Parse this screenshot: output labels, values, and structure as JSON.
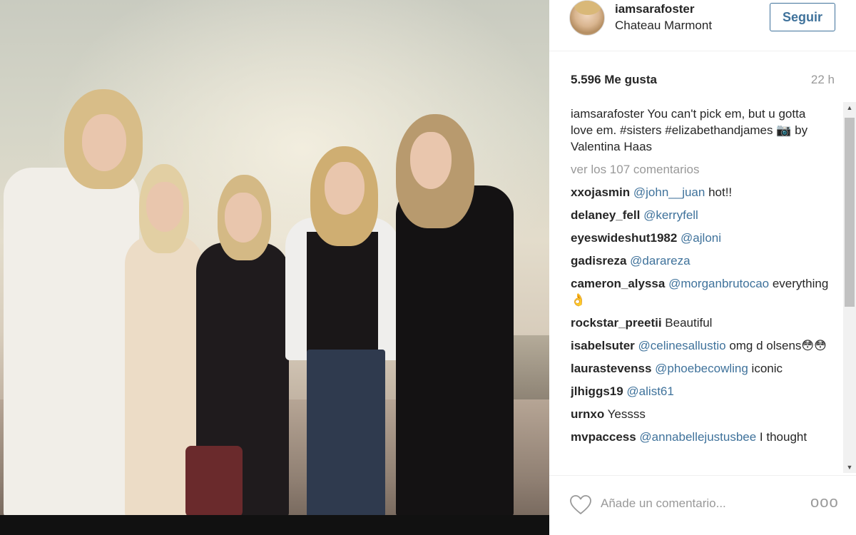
{
  "post": {
    "username": "iamsarafoster",
    "location": "Chateau Marmont",
    "follow_label": "Seguir",
    "likes": "5.596 Me gusta",
    "time": "22 h",
    "image_alt": "Group photo of five women at sunset on a terrace"
  },
  "caption": {
    "username": "iamsarafoster",
    "text_1": " You can't pick em, but u gotta love em. ",
    "hashtag_1": "#sisters",
    "hashtag_2": "#elizabethandjames",
    "text_2": " 📷 by Valentina Haas"
  },
  "view_all_comments": "ver los 107 comentarios",
  "comments": [
    {
      "user": "xxojasmin",
      "mention": "@john__juan",
      "text": " hot!!"
    },
    {
      "user": "delaney_fell",
      "mention": "@kerryfell",
      "text": ""
    },
    {
      "user": "eyeswideshut1982",
      "mention": "@ajloni",
      "text": ""
    },
    {
      "user": "gadisreza",
      "mention": "@darareza",
      "text": ""
    },
    {
      "user": "cameron_alyssa",
      "mention": "@morganbrutocao",
      "text": " everything 👌"
    },
    {
      "user": "rockstar_preetii",
      "mention": "",
      "text": " Beautiful"
    },
    {
      "user": "isabelsuter",
      "mention": "@celinesallustio",
      "text": " omg d olsens😳😳"
    },
    {
      "user": "laurastevenss",
      "mention": "@phoebecowling",
      "text": " iconic"
    },
    {
      "user": "jlhiggs19",
      "mention": "@alist61",
      "text": ""
    },
    {
      "user": "urnxo",
      "mention": "",
      "text": " Yessss"
    },
    {
      "user": "mvpaccess",
      "mention": "@annabellejustusbee",
      "text": " I thought"
    }
  ],
  "footer": {
    "comment_placeholder": "Añade un comentario...",
    "more_label": "ooo"
  },
  "icons": {
    "heart": "heart-icon",
    "more": "more-options-icon",
    "scroll_up": "scroll-up-arrow-icon",
    "scroll_down": "scroll-down-arrow-icon"
  },
  "colors": {
    "link_blue": "#3f729b",
    "muted_gray": "#999999",
    "text": "#262626"
  }
}
